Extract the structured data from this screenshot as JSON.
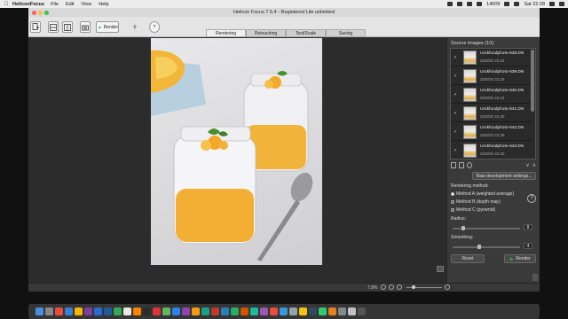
{
  "menubar": {
    "app_name": "HeliconFocus",
    "menus": [
      "File",
      "Edit",
      "View",
      "Help"
    ],
    "battery_count": "14009",
    "clock": "Sat 22:28"
  },
  "window": {
    "title": "Helicon Focus 7.5.4 - Registered Lite unlimited"
  },
  "toolbar": {
    "render_label": "Render"
  },
  "tabs": [
    "Rendering",
    "Retouching",
    "Text/Scale",
    "Saving"
  ],
  "source": {
    "title": "Source images (10):",
    "items": [
      {
        "name": "Urokfoodphoto-638.DN",
        "date": "3/28/20 22:24",
        "checked": "✓"
      },
      {
        "name": "Urokfoodphoto-639.DN",
        "date": "3/28/20 22:24",
        "checked": "✓"
      },
      {
        "name": "Urokfoodphoto-640.DN",
        "date": "3/28/20 22:24",
        "checked": "✓"
      },
      {
        "name": "Urokfoodphoto-641.DN",
        "date": "3/28/20 22:25",
        "checked": "✓"
      },
      {
        "name": "Urokfoodphoto-642.DN",
        "date": "3/28/20 22:25",
        "checked": "✓"
      },
      {
        "name": "Urokfoodphoto-643.DN",
        "date": "3/28/20 22:25",
        "checked": "✓"
      }
    ]
  },
  "raw_button": "Raw development settings...",
  "rendering": {
    "method_title": "Rendering method:",
    "methods": [
      "Method A (weighted average)",
      "Method B (depth map)",
      "Method C (pyramid)"
    ],
    "selected_method_index": 0,
    "radius_label": "Radius:",
    "radius_value": "8",
    "smoothing_label": "Smoothing:",
    "smoothing_value": "4",
    "reset_label": "Reset",
    "render_label": "Render",
    "help_icon": "?"
  },
  "status": {
    "zoom": "7.8%"
  },
  "colors": {
    "menubar": "#ececec",
    "panel": "#3a3a3a",
    "viewer": "#2c2c2c",
    "accent_render": "#2fa84f"
  }
}
